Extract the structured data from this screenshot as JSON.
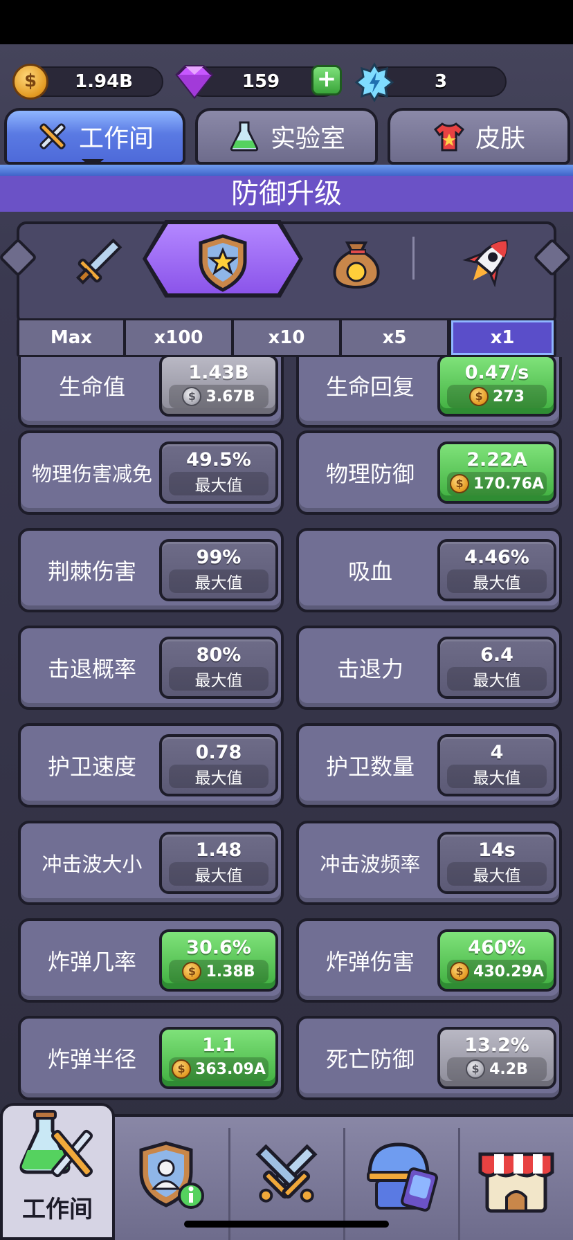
{
  "currency": {
    "coins": "1.94B",
    "gems": "159",
    "energy": "3",
    "coin_icon": "coin-icon",
    "gem_icon": "gem-icon",
    "energy_icon": "energy-icon",
    "coin_symbol": "$"
  },
  "tabs": [
    {
      "label": "工作间",
      "icon": "tools-icon",
      "active": true
    },
    {
      "label": "实验室",
      "icon": "flask-icon",
      "active": false
    },
    {
      "label": "皮肤",
      "icon": "shirt-icon",
      "active": false
    }
  ],
  "section_title": "防御升级",
  "categories": [
    {
      "icon": "sword-icon",
      "selected": false
    },
    {
      "icon": "shield-icon",
      "selected": true
    },
    {
      "icon": "money-bag-icon",
      "selected": false
    },
    {
      "icon": "rocket-icon",
      "selected": false
    }
  ],
  "multipliers": [
    {
      "label": "Max",
      "active": false
    },
    {
      "label": "x100",
      "active": false
    },
    {
      "label": "x10",
      "active": false
    },
    {
      "label": "x5",
      "active": false
    },
    {
      "label": "x1",
      "active": true
    }
  ],
  "max_label": "最大值",
  "stats": [
    {
      "name": "生命值",
      "value": "1.43B",
      "cost": "3.67B",
      "state": "gray"
    },
    {
      "name": "生命回复",
      "value": "0.47/s",
      "cost": "273",
      "state": "green"
    },
    {
      "name": "物理伤害减免",
      "value": "49.5%",
      "cost": "最大值",
      "state": "max"
    },
    {
      "name": "物理防御",
      "value": "2.22A",
      "cost": "170.76A",
      "state": "green"
    },
    {
      "name": "荆棘伤害",
      "value": "99%",
      "cost": "最大值",
      "state": "max"
    },
    {
      "name": "吸血",
      "value": "4.46%",
      "cost": "最大值",
      "state": "max"
    },
    {
      "name": "击退概率",
      "value": "80%",
      "cost": "最大值",
      "state": "max"
    },
    {
      "name": "击退力",
      "value": "6.4",
      "cost": "最大值",
      "state": "max"
    },
    {
      "name": "护卫速度",
      "value": "0.78",
      "cost": "最大值",
      "state": "max"
    },
    {
      "name": "护卫数量",
      "value": "4",
      "cost": "最大值",
      "state": "max"
    },
    {
      "name": "冲击波大小",
      "value": "1.48",
      "cost": "最大值",
      "state": "max"
    },
    {
      "name": "冲击波频率",
      "value": "14s",
      "cost": "最大值",
      "state": "max"
    },
    {
      "name": "炸弹几率",
      "value": "30.6%",
      "cost": "1.38B",
      "state": "green"
    },
    {
      "name": "炸弹伤害",
      "value": "460%",
      "cost": "430.29A",
      "state": "green"
    },
    {
      "name": "炸弹半径",
      "value": "1.1",
      "cost": "363.09A",
      "state": "green"
    },
    {
      "name": "死亡防御",
      "value": "13.2%",
      "cost": "4.2B",
      "state": "gray"
    }
  ],
  "bottom_nav": [
    {
      "label": "工作间",
      "icon": "workshop-icon",
      "active": true
    },
    {
      "icon": "profile-badge-icon",
      "active": false
    },
    {
      "icon": "crossed-swords-icon",
      "active": false
    },
    {
      "icon": "hero-cards-icon",
      "active": false
    },
    {
      "icon": "shop-icon",
      "active": false
    }
  ],
  "colors": {
    "accent_purple": "#6b52c6",
    "tab_active_blue": "#5a7ae3",
    "upgrade_green": "#3fae3f",
    "card_bg": "#716f94"
  }
}
